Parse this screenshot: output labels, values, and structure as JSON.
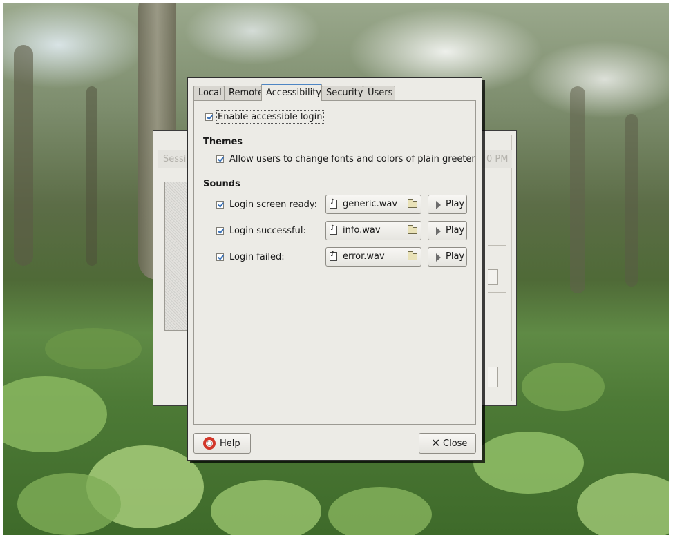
{
  "background": {
    "back_dialog": {
      "session_label": "Sessio",
      "time_label": "0 PM"
    }
  },
  "dialog": {
    "tabs": [
      {
        "label": "Local",
        "active": false
      },
      {
        "label": "Remote",
        "active": false
      },
      {
        "label": "Accessibility",
        "active": true
      },
      {
        "label": "Security",
        "active": false
      },
      {
        "label": "Users",
        "active": false
      }
    ],
    "enable_accessible_login": {
      "label": "Enable accessible login",
      "checked": true
    },
    "themes": {
      "heading": "Themes",
      "allow_fonts": {
        "label": "Allow users to change fonts and colors of plain greeter",
        "checked": true
      }
    },
    "sounds": {
      "heading": "Sounds",
      "rows": [
        {
          "label": "Login screen ready:",
          "checked": true,
          "file": "generic.wav",
          "play_label": "Play"
        },
        {
          "label": "Login successful:",
          "checked": true,
          "file": "info.wav",
          "play_label": "Play"
        },
        {
          "label": "Login failed:",
          "checked": true,
          "file": "error.wav",
          "play_label": "Play"
        }
      ]
    },
    "help_label": "Help",
    "close_label": "Close"
  },
  "icons": [
    "music-file-icon",
    "folder-open-icon",
    "play-icon",
    "help-lifebuoy-icon",
    "close-x-icon"
  ],
  "colors": {
    "active_tab_accent": "#4e86c4",
    "checkmark": "#3a72b8",
    "help_icon": "#d2372a"
  }
}
